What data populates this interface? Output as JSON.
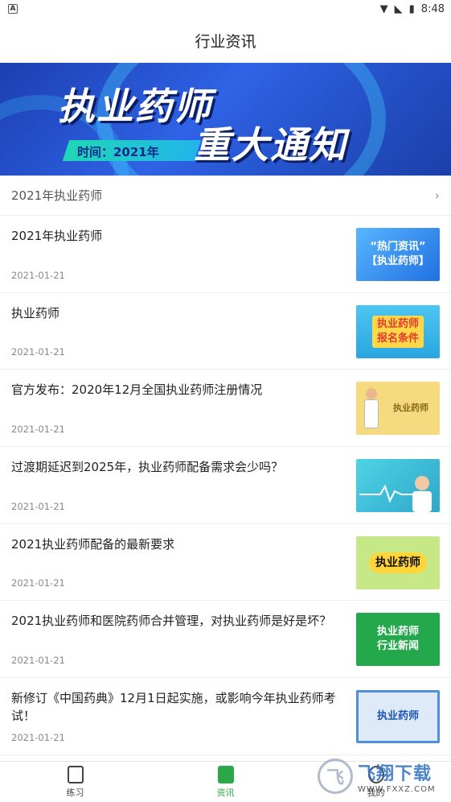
{
  "status_bar": {
    "time": "8:48",
    "left_badge": "A"
  },
  "header": {
    "title": "行业资讯"
  },
  "banner": {
    "line1": "执业药师",
    "line2": "重大通知",
    "date_text": "时间：2021年"
  },
  "section": {
    "label": "2021年执业药师"
  },
  "articles": [
    {
      "title": "2021年执业药师",
      "date": "2021-01-21",
      "thumb_text": "“热门资讯”\n【执业药师】",
      "thumb_bg": "#2f8ff0",
      "thumb_fg": "#ffffff"
    },
    {
      "title": "执业药师",
      "date": "2021-01-21",
      "thumb_text": "执业药师\n报名条件",
      "thumb_bg": "#3bb8e8",
      "thumb_fg": "#e53a2f"
    },
    {
      "title": "官方发布：2020年12月全国执业药师注册情况",
      "date": "2021-01-21",
      "thumb_text": "执业药师",
      "thumb_bg": "#f5d77a",
      "thumb_fg": "#8a6a1c"
    },
    {
      "title": "过渡期延迟到2025年，执业药师配备需求会少吗？",
      "date": "2021-01-21",
      "thumb_text": "",
      "thumb_bg": "#38c3d8",
      "thumb_fg": "#ffffff"
    },
    {
      "title": "2021执业药师配备的最新要求",
      "date": "2021-01-21",
      "thumb_text": "执业药师",
      "thumb_bg": "#bfe37a",
      "thumb_fg": "#111111"
    },
    {
      "title": "2021执业药师和医院药师合并管理，对执业药师是好是坏？",
      "date": "2021-01-21",
      "thumb_text": "执业药师\n行业新闻",
      "thumb_bg": "#22a64b",
      "thumb_fg": "#ffffff"
    },
    {
      "title": "新修订《中国药典》12月1日起实施，或影响今年执业药师考试！",
      "date": "2021-01-21",
      "thumb_text": "执业药师",
      "thumb_bg": "#e9f1fb",
      "thumb_fg": "#1e56b8"
    }
  ],
  "tabs": [
    {
      "label": "练习",
      "active": false
    },
    {
      "label": "资讯",
      "active": true
    },
    {
      "label": "我的",
      "active": false
    }
  ],
  "watermark": {
    "main": "飞翔下载",
    "sub": "WWW.FXXZ.COM"
  },
  "colors": {
    "accent": "#2aa84a",
    "banner_blue": "#2f62e6"
  }
}
